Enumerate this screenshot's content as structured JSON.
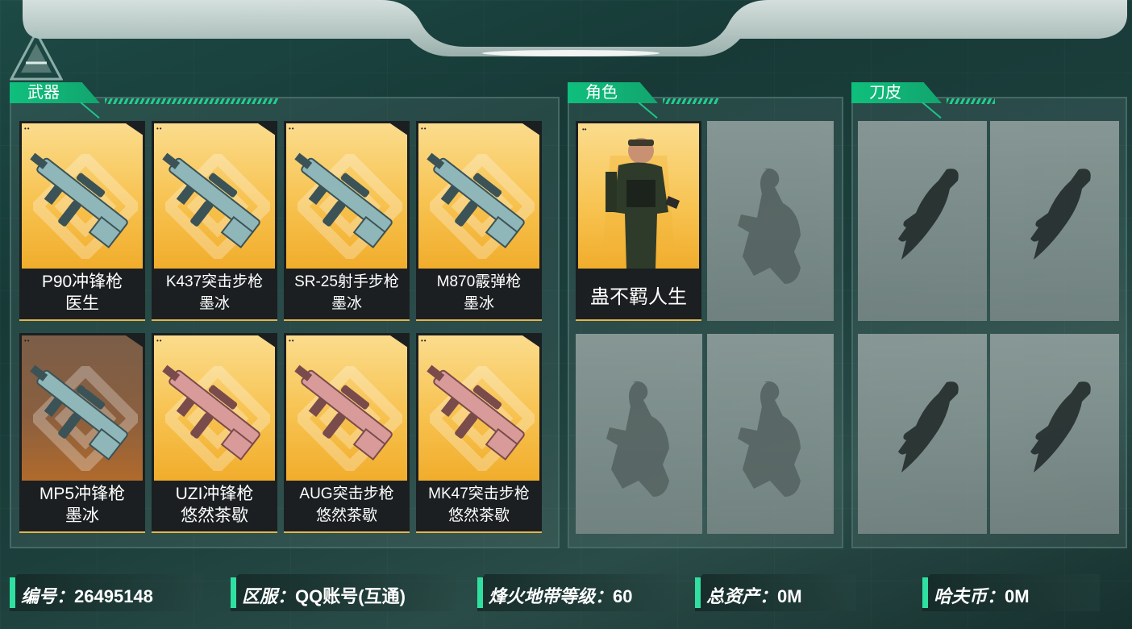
{
  "colors": {
    "accent": "#12b97a",
    "card_gold": "#f6c34d",
    "bg": "#1d4a45"
  },
  "panels": {
    "weapons": {
      "title": "武器",
      "items": [
        {
          "name": "P90冲锋枪",
          "skin": "医生",
          "bg": "gold",
          "icon": "p90-gun-icon"
        },
        {
          "name": "K437突击步枪",
          "skin": "墨冰",
          "bg": "gold",
          "icon": "k437-gun-icon"
        },
        {
          "name": "SR-25射手步枪",
          "skin": "墨冰",
          "bg": "gold",
          "icon": "sr25-gun-icon"
        },
        {
          "name": "M870霰弹枪",
          "skin": "墨冰",
          "bg": "gold",
          "icon": "m870-gun-icon"
        },
        {
          "name": "MP5冲锋枪",
          "skin": "墨冰",
          "bg": "brown",
          "icon": "mp5-gun-icon"
        },
        {
          "name": "UZI冲锋枪",
          "skin": "悠然茶歇",
          "bg": "gold",
          "icon": "uzi-gun-icon"
        },
        {
          "name": "AUG突击步枪",
          "skin": "悠然茶歇",
          "bg": "gold",
          "icon": "aug-gun-icon"
        },
        {
          "name": "MK47突击步枪",
          "skin": "悠然茶歇",
          "bg": "gold",
          "icon": "mk47-gun-icon"
        }
      ]
    },
    "roles": {
      "title": "角色",
      "items": [
        {
          "name": "蛊不羁人生",
          "icon": "operator-portrait"
        }
      ]
    },
    "knives": {
      "title": "刀皮"
    }
  },
  "footer": [
    {
      "label": "编号：",
      "value": "26495148"
    },
    {
      "label": "区服：",
      "value": "QQ账号(互通)"
    },
    {
      "label": "烽火地带等级：",
      "value": "60"
    },
    {
      "label": "总资产：",
      "value": "0M"
    },
    {
      "label": "哈夫币：",
      "value": "0M"
    }
  ]
}
